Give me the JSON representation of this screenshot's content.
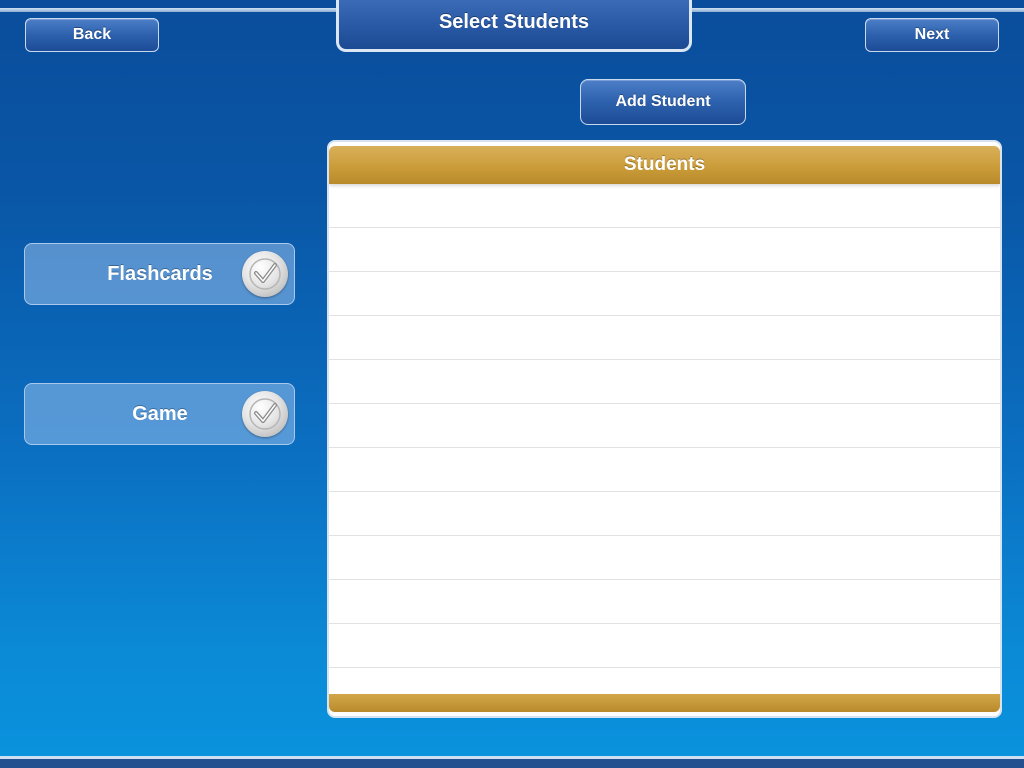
{
  "header": {
    "title": "Select Students",
    "back_label": "Back",
    "next_label": "Next"
  },
  "actions": {
    "add_student_label": "Add Student"
  },
  "options": [
    {
      "label": "Flashcards",
      "checked": true
    },
    {
      "label": "Game",
      "checked": true
    }
  ],
  "students_table": {
    "header": "Students",
    "rows": []
  },
  "colors": {
    "accent_gold": "#c99a37",
    "button_blue": "#2d61ad",
    "background_top": "#0a4d9c",
    "background_bottom": "#0a93de"
  }
}
